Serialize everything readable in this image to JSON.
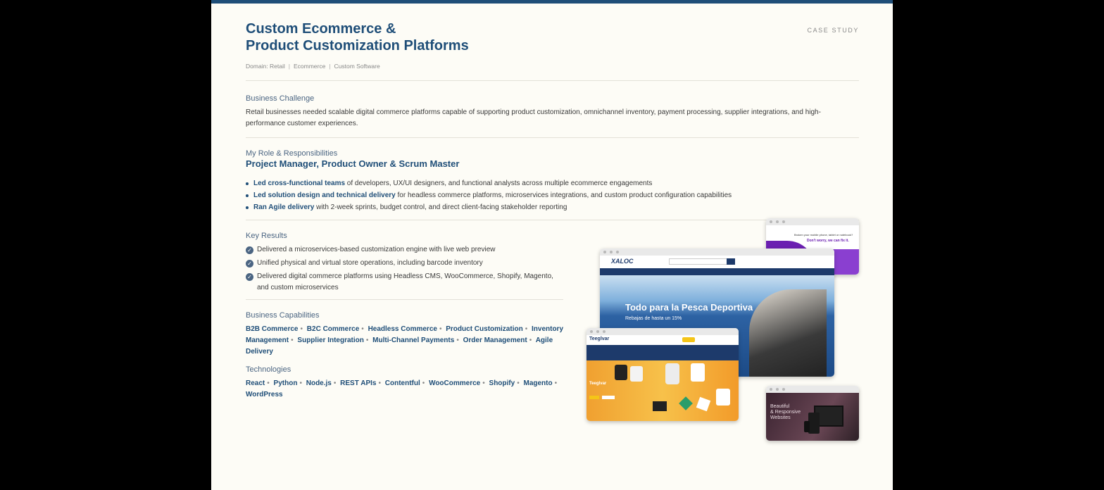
{
  "header": {
    "title_line1": "Custom Ecommerce &",
    "title_line2": "Product Customization Platforms",
    "tag": "CASE STUDY",
    "domain_items": [
      "Domain: Retail",
      "Ecommerce",
      "Custom Software"
    ],
    "domain_separator": "|"
  },
  "challenge": {
    "heading": "Business Challenge",
    "text": "Retail businesses needed scalable digital commerce platforms capable of supporting product customization, omnichannel inventory, payment processing, supplier integrations, and high-performance customer experiences."
  },
  "role": {
    "heading": "My Role & Responsibilities",
    "title": "Project Manager, Product Owner & Scrum Master",
    "bullets": [
      {
        "strong": "Led cross-functional teams",
        "rest": " of developers, UX/UI designers, and functional analysts across multiple ecommerce engagements"
      },
      {
        "strong": "Led solution design and technical delivery",
        "rest": " for headless commerce platforms, microservices integrations, and custom product configuration capabilities"
      },
      {
        "strong": "Ran Agile delivery",
        "rest": " with 2-week sprints, budget control, and direct client-facing stakeholder reporting"
      }
    ]
  },
  "results": {
    "heading": "Key Results",
    "check_glyph": "✓",
    "items": [
      "Delivered a microservices-based customization engine with live web preview",
      "Unified physical and virtual store operations, including barcode inventory",
      "Delivered digital commerce platforms using Headless CMS, WooCommerce, Shopify, Magento, and custom microservices"
    ]
  },
  "capabilities": {
    "heading": "Business Capabilities",
    "separator": "•",
    "items": [
      "B2B Commerce",
      "B2C Commerce",
      "Headless Commerce",
      "Product Customization",
      "Inventory Management",
      "Supplier Integration",
      "Multi-Channel Payments",
      "Order Management",
      "Agile Delivery"
    ]
  },
  "technologies": {
    "heading": "Technologies",
    "separator": "•",
    "items": [
      "React",
      "Python",
      "Node.js",
      "REST APIs",
      "Contentful",
      "WooCommerce",
      "Shopify",
      "Magento",
      "WordPress"
    ]
  },
  "screenshots": {
    "repair_site": {
      "headline": "Broken your mobile phone, tablet or notebook?",
      "tagline": "Don't worry, we can fix it."
    },
    "fishing_site": {
      "logo": "XALOC",
      "hero_title": "Todo para la Pesca Deportiva",
      "hero_subtitle": "Rebajas de hasta un 15%"
    },
    "apparel_site": {
      "logo": "Teeglvar",
      "hero_title": "Teeglvar"
    },
    "web_agency_site": {
      "headline_line1": "Beautiful",
      "headline_line2": "& Responsive",
      "headline_line3": "Websites"
    },
    "colors": {
      "accent": "#1f4e78",
      "sea": "#2d62a3",
      "orange": "#f29b2a",
      "purple": "#7b2fbf",
      "navy_bar": "#1d3a6b"
    }
  }
}
